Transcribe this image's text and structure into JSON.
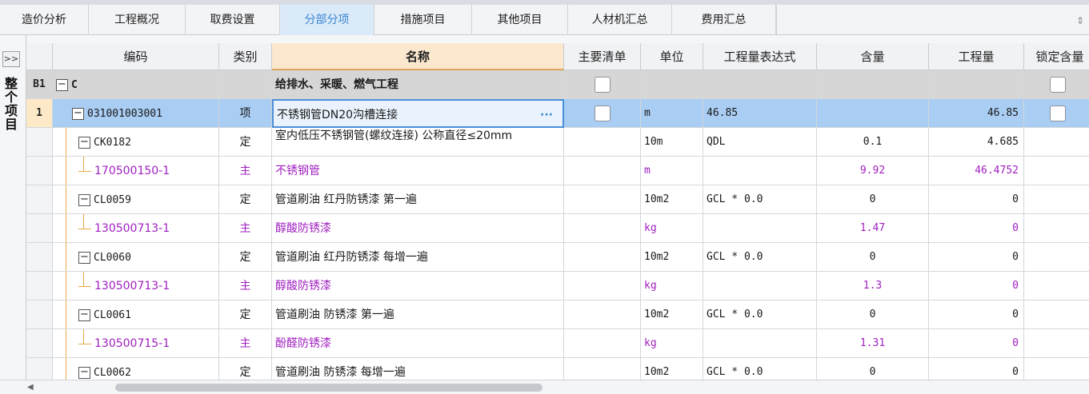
{
  "tabs": [
    {
      "label": "造价分析",
      "active": false
    },
    {
      "label": "工程概况",
      "active": false
    },
    {
      "label": "取费设置",
      "active": false
    },
    {
      "label": "分部分项",
      "active": true
    },
    {
      "label": "措施项目",
      "active": false
    },
    {
      "label": "其他项目",
      "active": false
    },
    {
      "label": "人材机汇总",
      "active": false
    },
    {
      "label": "费用汇总",
      "active": false
    }
  ],
  "left_panel": {
    "expand_label": ">>",
    "vertical_label": "整个项目"
  },
  "columns": [
    "编码",
    "类别",
    "名称",
    "主要清单",
    "单位",
    "工程量表达式",
    "含量",
    "工程量",
    "锁定含量"
  ],
  "rows": [
    {
      "kind": "group",
      "idx": "B1",
      "code": "C",
      "type": "",
      "name": "给排水、采暖、燃气工程",
      "unit": "",
      "expr": "",
      "content": "",
      "qty": "",
      "main_cb": true,
      "lock_cb": true
    },
    {
      "kind": "sel",
      "idx": "1",
      "code": "031001003001",
      "type": "项",
      "name": "不锈钢管DN20沟槽连接",
      "unit": "m",
      "expr": "46.85",
      "content": "",
      "qty": "46.85",
      "main_cb": true,
      "lock_cb": true
    },
    {
      "kind": "quota",
      "idx": "",
      "code": "CK0182",
      "type": "定",
      "name": "室内低压不锈钢管(螺纹连接) 公称直径≤20mm",
      "unit": "10m",
      "expr": "QDL",
      "content": "0.1",
      "qty": "4.685"
    },
    {
      "kind": "main",
      "idx": "",
      "code": "170500150-1",
      "type": "主",
      "name": "不锈钢管",
      "unit": "m",
      "expr": "",
      "content": "9.92",
      "qty": "46.4752"
    },
    {
      "kind": "quota",
      "idx": "",
      "code": "CL0059",
      "type": "定",
      "name": "管道刷油 红丹防锈漆 第一遍",
      "unit": "10m2",
      "expr": "GCL * 0.0",
      "content": "0",
      "qty": "0"
    },
    {
      "kind": "main",
      "idx": "",
      "code": "130500713-1",
      "type": "主",
      "name": "醇酸防锈漆",
      "unit": "kg",
      "expr": "",
      "content": "1.47",
      "qty": "0"
    },
    {
      "kind": "quota",
      "idx": "",
      "code": "CL0060",
      "type": "定",
      "name": "管道刷油 红丹防锈漆 每增一遍",
      "unit": "10m2",
      "expr": "GCL * 0.0",
      "content": "0",
      "qty": "0"
    },
    {
      "kind": "main",
      "idx": "",
      "code": "130500713-1",
      "type": "主",
      "name": "醇酸防锈漆",
      "unit": "kg",
      "expr": "",
      "content": "1.3",
      "qty": "0"
    },
    {
      "kind": "quota",
      "idx": "",
      "code": "CL0061",
      "type": "定",
      "name": "管道刷油 防锈漆 第一遍",
      "unit": "10m2",
      "expr": "GCL * 0.0",
      "content": "0",
      "qty": "0"
    },
    {
      "kind": "main",
      "idx": "",
      "code": "130500715-1",
      "type": "主",
      "name": "酚醛防锈漆",
      "unit": "kg",
      "expr": "",
      "content": "1.31",
      "qty": "0"
    },
    {
      "kind": "quota",
      "idx": "",
      "code": "CL0062",
      "type": "定",
      "name": "管道刷油 防锈漆 每增一遍",
      "unit": "10m2",
      "expr": "GCL * 0.0",
      "content": "0",
      "qty": "0"
    }
  ],
  "colors": {
    "accent": "#3a86d4",
    "selected_row": "#a9cdf3",
    "main_material": "#a020c0",
    "group_row": "#d6d6d6",
    "tree_line": "#e8a94a"
  }
}
